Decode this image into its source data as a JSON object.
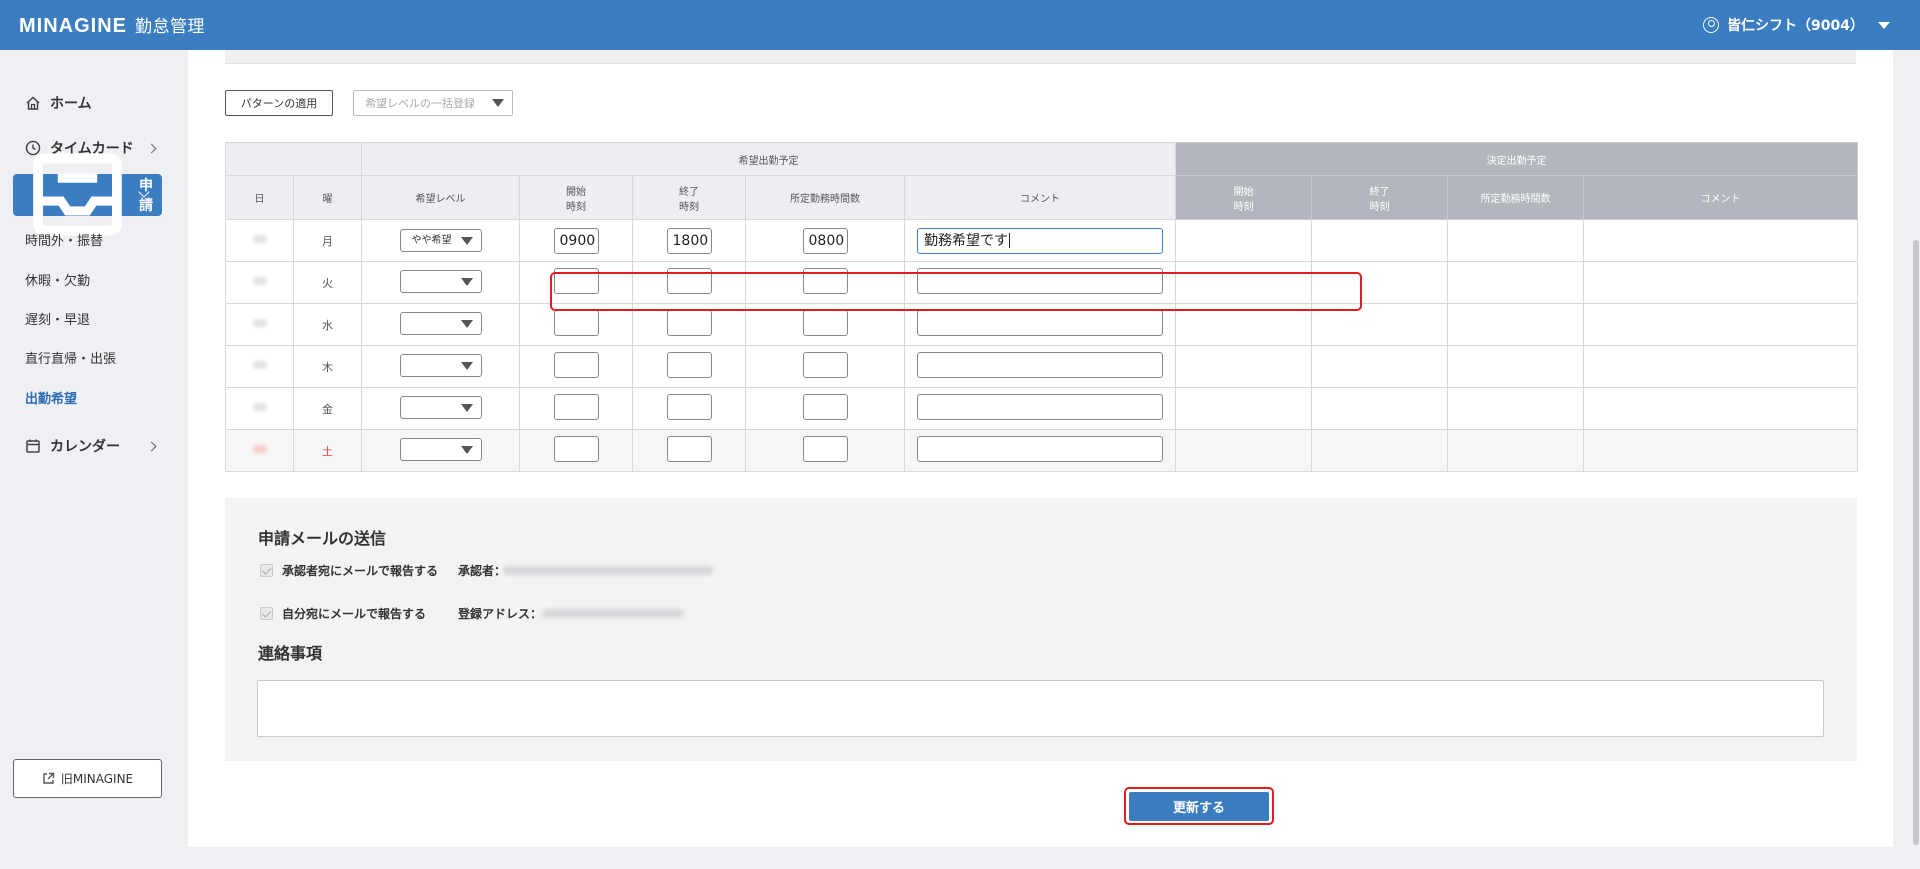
{
  "header": {
    "logo": "MINAGINE",
    "app_name": "勤怠管理",
    "user": "皆仁シフト（9004）"
  },
  "sidebar": {
    "home": "ホーム",
    "timecard": "タイムカード",
    "request": "申請",
    "sub_items": [
      "時間外・振替",
      "休暇・欠勤",
      "遅刻・早退",
      "直行直帰・出張",
      "出勤希望"
    ],
    "calendar": "カレンダー",
    "old_link": "旧MINAGINE"
  },
  "toolbar": {
    "pattern_button": "パターンの適用",
    "bulk_select": "希望レベルの一括登録"
  },
  "table": {
    "group_wish": "希望出勤予定",
    "group_decided": "決定出勤予定",
    "col_day": "日",
    "col_dow": "曜",
    "col_level": "希望レベル",
    "col_start_1": "開始",
    "col_start_2": "時刻",
    "col_end_1": "終了",
    "col_end_2": "時刻",
    "col_hours": "所定勤務時間数",
    "col_comment": "コメント",
    "rows": [
      {
        "dow": "月",
        "level": "やや希望",
        "start": "0900",
        "end": "1800",
        "hours": "0800",
        "comment": "勤務希望です"
      },
      {
        "dow": "火",
        "level": "",
        "start": "",
        "end": "",
        "hours": "",
        "comment": ""
      },
      {
        "dow": "水",
        "level": "",
        "start": "",
        "end": "",
        "hours": "",
        "comment": ""
      },
      {
        "dow": "木",
        "level": "",
        "start": "",
        "end": "",
        "hours": "",
        "comment": ""
      },
      {
        "dow": "金",
        "level": "",
        "start": "",
        "end": "",
        "hours": "",
        "comment": ""
      },
      {
        "dow": "土",
        "level": "",
        "start": "",
        "end": "",
        "hours": "",
        "comment": ""
      }
    ]
  },
  "mail": {
    "title": "申請メールの送信",
    "approver_check": "承認者宛にメールで報告する",
    "approver_label": "承認者：",
    "self_check": "自分宛にメールで報告する",
    "self_label": "登録アドレス：",
    "notes_title": "連絡事項"
  },
  "submit": {
    "label": "更新する"
  },
  "colors": {
    "primary": "#3b7dc1",
    "highlight": "#e01e1e",
    "decided_header": "#b3b6bc",
    "saturday": "#e04545"
  }
}
